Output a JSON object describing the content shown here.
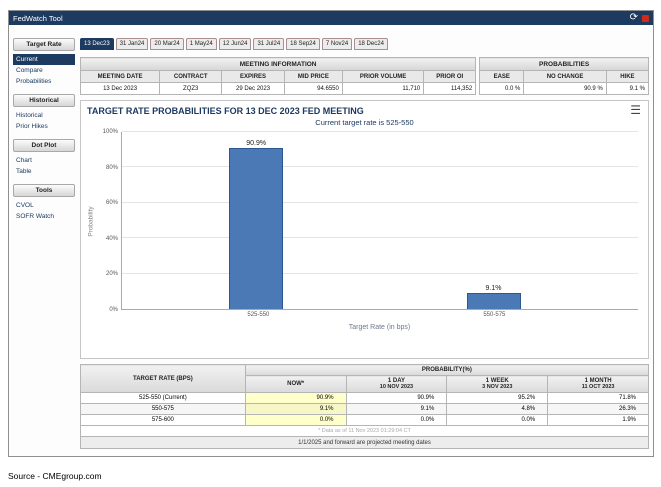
{
  "colors": {
    "brand_navy": "#1d3a60",
    "bar_blue": "#4a79b5",
    "now_highlight": "#ffffcc",
    "badge_red": "#cf2a1b"
  },
  "icons": {
    "menu": "☰",
    "refresh": "⟳"
  },
  "titlebar": {
    "title": "FedWatch Tool"
  },
  "tabs": {
    "items": [
      "13 Dec23",
      "31 Jan24",
      "20 Mar24",
      "1 May24",
      "12 Jun24",
      "31 Jul24",
      "18 Sep24",
      "7 Nov24",
      "18 Dec24"
    ],
    "selected": "13 Dec23"
  },
  "sidebar": {
    "sections": [
      {
        "header": "Target Rate",
        "items": [
          "Current",
          "Compare",
          "Probabilities"
        ]
      },
      {
        "header": "Historical",
        "items": [
          "Historical",
          "Prior Hikes"
        ]
      },
      {
        "header": "Dot Plot",
        "items": [
          "Chart",
          "Table"
        ]
      },
      {
        "header": "Tools",
        "items": [
          "CVOL",
          "SOFR Watch"
        ]
      }
    ]
  },
  "meeting_info": {
    "title": "MEETING INFORMATION",
    "headers": [
      "MEETING DATE",
      "CONTRACT",
      "EXPIRES",
      "MID PRICE",
      "PRIOR VOLUME",
      "PRIOR OI"
    ],
    "values": [
      "13 Dec 2023",
      "ZQZ3",
      "29 Dec 2023",
      "94.6550",
      "11,710",
      "114,352"
    ]
  },
  "probabilities": {
    "title": "PROBABILITIES",
    "headers": [
      "EASE",
      "NO CHANGE",
      "HIKE"
    ],
    "values": [
      "0.0 %",
      "90.9 %",
      "9.1 %"
    ]
  },
  "chart_data": {
    "type": "bar",
    "title": "TARGET RATE PROBABILITIES FOR 13 DEC 2023 FED MEETING",
    "subtitle": "Current target rate is 525-550",
    "categories": [
      "525-550",
      "550-575"
    ],
    "values": [
      90.9,
      9.1
    ],
    "bar_labels": [
      "90.9%",
      "9.1%"
    ],
    "xlabel": "Target Rate (in bps)",
    "ylabel": "Probability",
    "ylim": [
      0,
      100
    ],
    "yticks": [
      "100%",
      "80%",
      "60%",
      "40%",
      "20%",
      "0%"
    ],
    "grid": true,
    "legend": false,
    "bar_color": "#4a79b5"
  },
  "bottom_table": {
    "row_header": "TARGET RATE (BPS)",
    "group_header": "PROBABILITY(%)",
    "columns": [
      {
        "label": "NOW*",
        "date": ""
      },
      {
        "label": "1 DAY",
        "date": "10 NOV 2023"
      },
      {
        "label": "1 WEEK",
        "date": "3 NOV 2023"
      },
      {
        "label": "1 MONTH",
        "date": "11 OCT 2023"
      }
    ],
    "rows": [
      {
        "label": "525-550 (Current)",
        "values": [
          "90.9%",
          "90.9%",
          "95.2%",
          "71.8%"
        ]
      },
      {
        "label": "550-575",
        "values": [
          "9.1%",
          "9.1%",
          "4.8%",
          "26.3%"
        ]
      },
      {
        "label": "575-600",
        "values": [
          "0.0%",
          "0.0%",
          "0.0%",
          "1.9%"
        ]
      }
    ],
    "footnote": "* Data as of 11 Nov 2023 01:29:04 CT",
    "note": "1/1/2025 and forward are projected meeting dates"
  },
  "footer": {
    "source": "Source - CMEgroup.com"
  }
}
